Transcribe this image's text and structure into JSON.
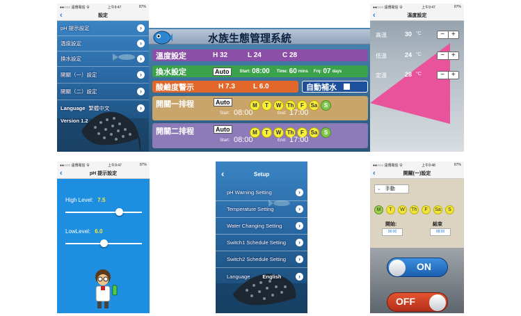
{
  "p1": {
    "status_left": "●●○○○ 遠傳電信 令",
    "status_time": "上午9:47",
    "status_right": "87%",
    "title": "設定",
    "back": "‹",
    "items": [
      "pH 提示設定",
      "溫度設定",
      "換水設定",
      "開關（一）設定",
      "開關（二）設定"
    ],
    "language_label": "Language",
    "language_value": "繁體中文",
    "version": "Version 1.2"
  },
  "p2": {
    "title": "水族生態管理系統",
    "temp_label": "溫度設定",
    "temp_h": "H 32",
    "temp_l": "L 24",
    "temp_c": "C 28",
    "water_label": "換水設定",
    "water_mode": "Auto",
    "water_start_label": "Start:",
    "water_start": "08:00",
    "water_time_label": "Time:",
    "water_time": "60",
    "water_time_unit": "mins",
    "water_frq_label": "Frq:",
    "water_frq": "07",
    "water_frq_unit": "days",
    "ph_label": "酸鹼度警示",
    "ph_h": "H 7.3",
    "ph_l": "L 6.0",
    "auto_fill_label": "自動補水",
    "sw1_label": "開關一排程",
    "sw1_mode": "Auto",
    "sw1_start_label": "Start:",
    "sw1_start": "08:00",
    "sw1_end_label": "End:",
    "sw1_end": "17:00",
    "sw2_label": "開關二排程",
    "sw2_mode": "Auto",
    "sw2_start_label": "Start:",
    "sw2_start": "08:00",
    "sw2_end_label": "End:",
    "sw2_end": "17:00",
    "days": [
      "M",
      "T",
      "W",
      "Th",
      "F",
      "Sa",
      "S"
    ]
  },
  "p3": {
    "status_left": "●●○○○ 遠傳電信 令",
    "status_time": "上午9:47",
    "status_right": "87%",
    "title": "溫度設定",
    "back": "‹",
    "rows": [
      {
        "label": "高溫",
        "value": "30",
        "unit": "°C"
      },
      {
        "label": "低溫",
        "value": "24",
        "unit": "°C"
      },
      {
        "label": "定溫",
        "value": "28",
        "unit": "°C"
      }
    ],
    "minus": "−",
    "plus": "+",
    "accent": "#e8539b"
  },
  "p4": {
    "status_left": "●●○○○ 遠傳電信 令",
    "status_time": "上午9:47",
    "status_right": "87%",
    "title": "pH 提示設定",
    "back": "‹",
    "high_label": "High Level:",
    "high_value": "7.5",
    "high_fraction": 0.7,
    "low_label": "LowLevel:",
    "low_value": "6.0",
    "low_fraction": 0.5,
    "bg": "#1e8ee0"
  },
  "p5": {
    "back": "‹",
    "title": "Setup",
    "items": [
      "pH Warning Setting",
      "Temperature Setting",
      "Water Changing Setting",
      "Switch1 Schedule Setting",
      "Switch2 Schedule Setting"
    ],
    "language_label": "Language",
    "language_value": "English"
  },
  "p6": {
    "status_left": "●●○○○ 遠傳電信 令",
    "status_time": "上午9:48",
    "status_right": "87%",
    "title": "開關(一)設定",
    "back": "‹",
    "mode_value": "手動",
    "days": [
      "M",
      "T",
      "W",
      "Th",
      "F",
      "Sa",
      "S"
    ],
    "start_label": "開始:",
    "start_value": "06:00",
    "end_label": "結束",
    "end_value": "08:00",
    "on_label": "ON",
    "off_label": "OFF"
  }
}
